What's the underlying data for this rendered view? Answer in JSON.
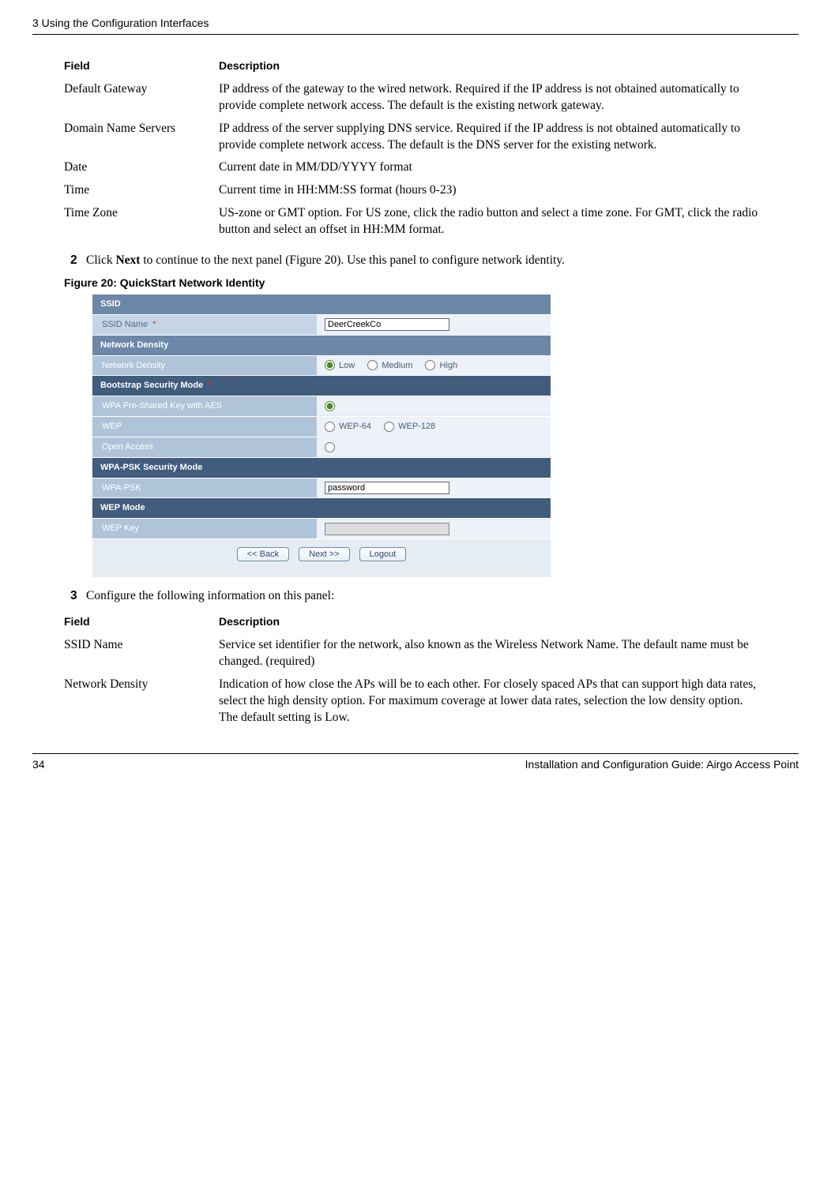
{
  "header": {
    "chapter": "3  Using the Configuration Interfaces"
  },
  "table1": {
    "headers": {
      "field": "Field",
      "description": "Description"
    },
    "rows": [
      {
        "field": "Default Gateway",
        "desc": "IP address of the gateway to the wired network. Required if the IP address is not obtained automatically to provide complete network access. The default is the existing network gateway."
      },
      {
        "field": "Domain Name Servers",
        "desc": "IP address of the server supplying DNS service. Required if the IP address is not obtained automatically to provide complete network access. The default is the DNS server for the existing network."
      },
      {
        "field": "Date",
        "desc": "Current date in MM/DD/YYYY format"
      },
      {
        "field": "Time",
        "desc": "Current time in HH:MM:SS format (hours 0-23)"
      },
      {
        "field": "Time Zone",
        "desc": "US-zone or GMT option. For US zone, click the radio button and select a time zone. For GMT, click the radio button and select an offset in HH:MM format."
      }
    ]
  },
  "steps": {
    "s2_num": "2",
    "s2a": "Click ",
    "s2b": "Next",
    "s2c": " to continue to the next panel (Figure 20). Use this panel to configure network identity.",
    "s3_num": "3",
    "s3": "Configure the following information on this panel:"
  },
  "figure": {
    "caption": "Figure 20:     QuickStart Network Identity"
  },
  "panel": {
    "ssid_hdr": "SSID",
    "ssid_label": "SSID Name",
    "ssid_value": "DeerCreekCo",
    "density_hdr": "Network Density",
    "density_label": "Network Density",
    "density_opts": {
      "low": "Low",
      "med": "Medium",
      "high": "High"
    },
    "sec_hdr": "Bootstrap Security Mode",
    "wpa_aes": "WPA Pre-Shared Key with AES",
    "wep": "WEP",
    "wep64": "WEP-64",
    "wep128": "WEP-128",
    "open": "Open Access",
    "wpapsk_hdr": "WPA-PSK Security Mode",
    "wpapsk_label": "WPA-PSK",
    "wpapsk_value": "password",
    "wepmode_hdr": "WEP Mode",
    "wepkey_label": "WEP Key",
    "btn_back": "<< Back",
    "btn_next": "Next >>",
    "btn_logout": "Logout",
    "asterisk": "*"
  },
  "table2": {
    "headers": {
      "field": "Field",
      "description": "Description"
    },
    "rows": [
      {
        "field": "SSID Name",
        "desc": "Service set identifier for the network, also known as the Wireless Network Name. The default name must be changed. (required)"
      },
      {
        "field": "Network Density",
        "desc": "Indication of how close the APs will be to each other. For closely spaced APs that can support high data rates, select the high density option. For maximum coverage at lower data rates, selection the low density option. The default setting is Low."
      }
    ]
  },
  "footer": {
    "page": "34",
    "title": "Installation and Configuration Guide: Airgo Access Point"
  }
}
